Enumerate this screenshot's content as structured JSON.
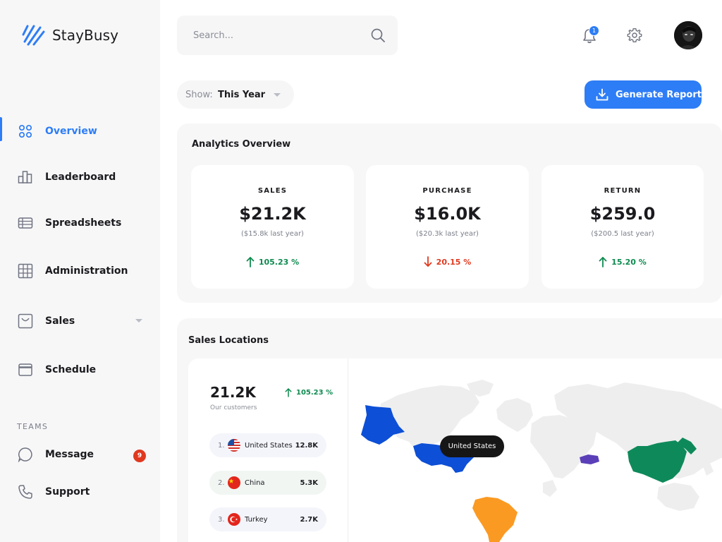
{
  "brand": {
    "name": "StayBusy"
  },
  "sidebar": {
    "items": [
      {
        "label": "Overview",
        "icon": "grid-icon",
        "active": true
      },
      {
        "label": "Leaderboard",
        "icon": "bar-chart-icon"
      },
      {
        "label": "Spreadsheets",
        "icon": "table-icon"
      },
      {
        "label": "Administration",
        "icon": "grid-layout-icon"
      },
      {
        "label": "Sales",
        "icon": "bag-icon"
      },
      {
        "label": "Schedule",
        "icon": "calendar-icon"
      }
    ],
    "teams_title": "TEAMS",
    "team_items": [
      {
        "label": "Message",
        "icon": "chat-bubble-icon",
        "badge": "9"
      },
      {
        "label": "Support",
        "icon": "phone-icon"
      }
    ]
  },
  "topbar": {
    "search_placeholder": "Search...",
    "notifications_count": "1"
  },
  "filter": {
    "show_label": "Show:",
    "show_value": "This Year",
    "generate_label": "Generate Report"
  },
  "analytics": {
    "title": "Analytics Overview",
    "stats": [
      {
        "title": "SALES",
        "value": "$21.2K",
        "previous": "($15.8k last year)",
        "delta": "105.23 %",
        "direction": "up"
      },
      {
        "title": "PURCHASE",
        "value": "$16.0K",
        "previous": "($20.3k last year)",
        "delta": "20.15 %",
        "direction": "down"
      },
      {
        "title": "RETURN",
        "value": "$259.0",
        "previous": "($200.5 last year)",
        "delta": "15.20 %",
        "direction": "up"
      }
    ]
  },
  "locations": {
    "title": "Sales Locations",
    "customers_value": "21.2K",
    "customers_label": "Our customers",
    "customers_delta": "105.23 %",
    "countries": [
      {
        "rank": "1.",
        "name": "United States",
        "value": "12.8K"
      },
      {
        "rank": "2.",
        "name": "China",
        "value": "5.3K"
      },
      {
        "rank": "3.",
        "name": "Turkey",
        "value": "2.7K"
      }
    ],
    "tooltip": "United States"
  },
  "colors": {
    "accent": "#2d7df6",
    "up": "#0e8a4f",
    "down": "#e0391f",
    "map_us": "#0d4fd6",
    "map_china": "#0e8a5a",
    "map_brazil": "#fb9a22",
    "map_turkey": "#5b3fb8"
  }
}
